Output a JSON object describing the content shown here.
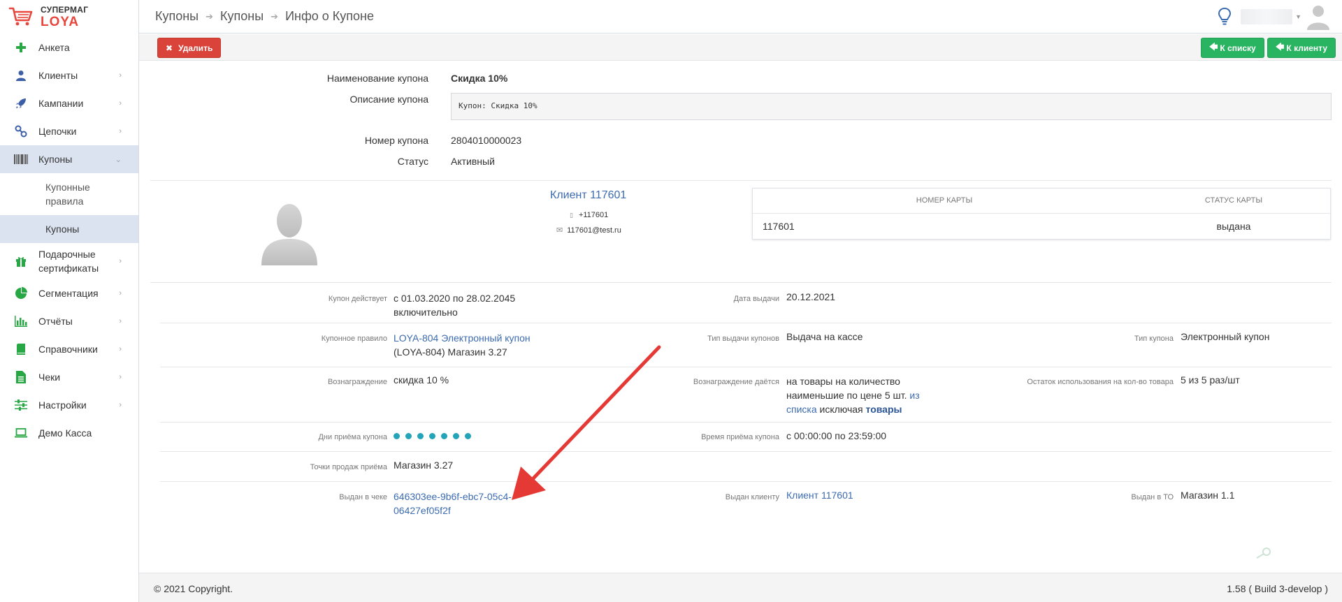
{
  "logo": {
    "line1": "СУПЕРМАГ",
    "line2": "LOYA"
  },
  "sidebar": {
    "items": [
      {
        "label": "Анкета",
        "icon": "plus-icon"
      },
      {
        "label": "Клиенты",
        "icon": "user-icon"
      },
      {
        "label": "Кампании",
        "icon": "rocket-icon"
      },
      {
        "label": "Цепочки",
        "icon": "chain-icon"
      },
      {
        "label": "Купоны",
        "icon": "barcode-icon"
      },
      {
        "label": "Подарочные сертификаты",
        "icon": "gift-icon"
      },
      {
        "label": "Сегментация",
        "icon": "pie-icon"
      },
      {
        "label": "Отчёты",
        "icon": "bar-chart-icon"
      },
      {
        "label": "Справочники",
        "icon": "book-icon"
      },
      {
        "label": "Чеки",
        "icon": "receipt-icon"
      },
      {
        "label": "Настройки",
        "icon": "sliders-icon"
      },
      {
        "label": "Демо Касса",
        "icon": "laptop-icon"
      }
    ],
    "subitems": [
      {
        "label": "Купонные правила"
      },
      {
        "label": "Купоны"
      }
    ]
  },
  "breadcrumb": [
    "Купоны",
    "Купоны",
    "Инфо о Купоне"
  ],
  "toolbar": {
    "delete_label": "Удалить",
    "to_list_label": "К списку",
    "to_client_label": "К клиенту"
  },
  "coupon": {
    "name_label": "Наименование купона",
    "name_value": "Скидка 10%",
    "desc_label": "Описание купона",
    "desc_value": "Купон: Скидка 10%",
    "number_label": "Номер купона",
    "number_value": "2804010000023",
    "status_label": "Статус",
    "status_value": "Активный"
  },
  "client": {
    "name": "Клиент 117601",
    "phone": "+117601",
    "email": "117601@test.ru"
  },
  "card_table": {
    "headers": [
      "НОМЕР КАРТЫ",
      "СТАТУС КАРТЫ"
    ],
    "rows": [
      [
        "117601",
        "выдана"
      ]
    ]
  },
  "details": {
    "valid_label": "Купон действует",
    "valid_value_1": "с 01.03.2020 по 28.02.2045",
    "valid_value_2": "включительно",
    "issue_date_label": "Дата выдачи",
    "issue_date_value": "20.12.2021",
    "rule_label": "Купонное правило",
    "rule_link": "LOYA-804 Электронный купон",
    "rule_extra": "(LOYA-804) Магазин 3.27",
    "issue_type_label": "Тип выдачи купонов",
    "issue_type_value": "Выдача на кассе",
    "coupon_type_label": "Тип купона",
    "coupon_type_value": "Электронный купон",
    "reward_label": "Вознаграждение",
    "reward_value": "скидка 10 %",
    "reward_given_label": "Вознаграждение даётся",
    "reward_given_1": "на товары на количество",
    "reward_given_2a": "наименьшие по цене 5 шт.",
    "reward_given_2b": "из",
    "reward_given_3a": "списка",
    "reward_given_3b": "исключая",
    "reward_given_3c": "товары",
    "remaining_label": "Остаток использования на кол-во товара",
    "remaining_value": "5 из 5 раз/шт",
    "days_label": "Дни приёма купона",
    "days_count": 7,
    "time_label": "Время приёма купона",
    "time_value": "с 00:00:00 по 23:59:00",
    "pos_label": "Точки продаж приёма",
    "pos_value": "Магазин 3.27",
    "receipt_label": "Выдан в чеке",
    "receipt_1": "646303ee-9b6f-ebc7-05c4-",
    "receipt_2": "06427ef05f2f",
    "issued_client_label": "Выдан клиенту",
    "issued_client_value": "Клиент 117601",
    "issued_to_label": "Выдан в ТО",
    "issued_to_value": "Магазин 1.1"
  },
  "footer": {
    "copyright": "© 2021 Copyright.",
    "version": "1.58 ( Build 3-develop )"
  },
  "colors": {
    "accent": "#3c6bb0",
    "danger": "#d9433a",
    "success": "#28b461",
    "annotation": "#e53935"
  }
}
